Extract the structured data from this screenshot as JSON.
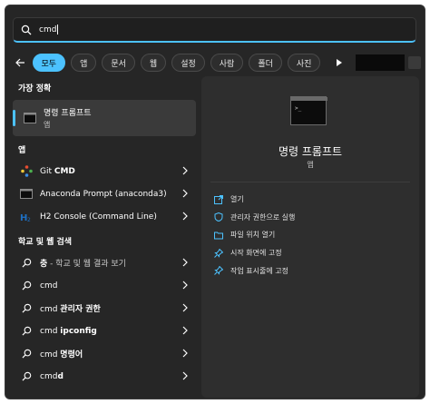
{
  "search": {
    "query": "cmd"
  },
  "filters": [
    {
      "label": "모두",
      "active": true
    },
    {
      "label": "앱",
      "active": false
    },
    {
      "label": "문서",
      "active": false
    },
    {
      "label": "웹",
      "active": false
    },
    {
      "label": "설정",
      "active": false
    },
    {
      "label": "사람",
      "active": false
    },
    {
      "label": "폴더",
      "active": false
    },
    {
      "label": "사진",
      "active": false
    }
  ],
  "best_match": {
    "heading": "가장 정확",
    "title": "명령 프롬프트",
    "subtitle": "앱"
  },
  "apps": {
    "heading": "앱",
    "items": [
      {
        "prefix": "Git ",
        "bold": "CMD",
        "suffix": ""
      },
      {
        "prefix": "Anaconda Prompt (anaconda3)",
        "bold": "",
        "suffix": ""
      },
      {
        "prefix": "H2 Console (Command Line)",
        "bold": "",
        "suffix": ""
      }
    ]
  },
  "web": {
    "heading": "학교 및 웹 검색",
    "items": [
      {
        "prefix": "",
        "bold": "충",
        "suffix": " - 학교 및 웹 결과 보기"
      },
      {
        "prefix": "cmd",
        "bold": "",
        "suffix": ""
      },
      {
        "prefix": "cmd ",
        "bold": "관리자 권한",
        "suffix": ""
      },
      {
        "prefix": "cmd ",
        "bold": "ipconfig",
        "suffix": ""
      },
      {
        "prefix": "cmd ",
        "bold": "명령어",
        "suffix": ""
      },
      {
        "prefix": "cmd",
        "bold": "d",
        "suffix": ""
      }
    ]
  },
  "preview": {
    "title": "명령 프롬프트",
    "subtitle": "앱",
    "actions": [
      {
        "label": "열기",
        "icon": "open-icon"
      },
      {
        "label": "관리자 권한으로 실행",
        "icon": "shield-icon"
      },
      {
        "label": "파일 위치 열기",
        "icon": "folder-icon"
      },
      {
        "label": "시작 화면에 고정",
        "icon": "pin-icon"
      },
      {
        "label": "작업 표시줄에 고정",
        "icon": "pin-icon"
      }
    ]
  },
  "colors": {
    "accent": "#4cc2ff",
    "panel": "#262626",
    "preview": "#2e2e2e"
  }
}
